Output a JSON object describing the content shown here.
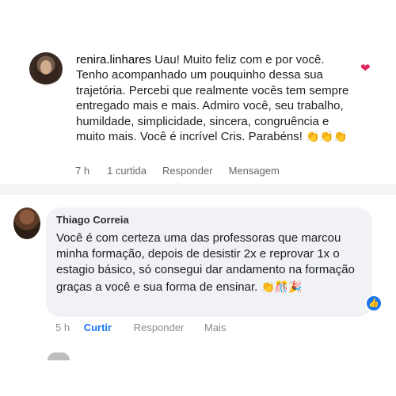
{
  "comment1": {
    "author": "renira.linhares",
    "text": "Uau! Muito feliz com e por você. Tenho acompanhado um pouquinho dessa sua trajetória. Percebi que realmente vocês tem sempre entregado mais e mais. Admiro você, seu trabalho, humildade, simplicidade, sincera, congruência e muito mais. Você é incrível Cris. Parabéns!",
    "emoji": "👏👏👏",
    "time": "7 h",
    "likes": "1 curtida",
    "reply": "Responder",
    "message": "Mensagem",
    "heart_icon": "heart-icon",
    "heart_color": "#e0245e"
  },
  "comment2": {
    "author": "Thiago Correia",
    "text": "Você é com certeza uma das professoras que marcou minha formação, depois de desistir 2x e reprovar 1x o estagio básico, só consegui dar andamento na formação graças a você e sua forma de ensinar.",
    "emoji": "👏🎊🎉",
    "time": "5 h",
    "like": "Curtir",
    "reply": "Responder",
    "more": "Mais",
    "reaction_icon": "thumbs-up-icon",
    "accent_color": "#1877f2"
  }
}
